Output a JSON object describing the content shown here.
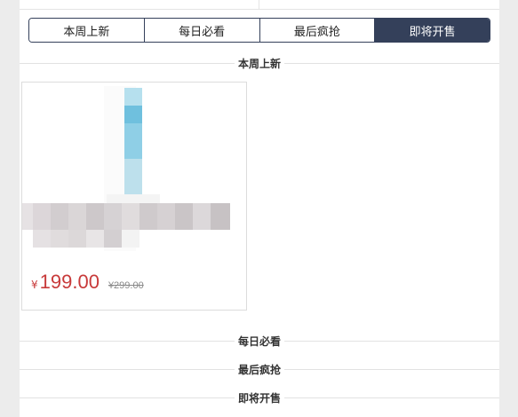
{
  "tabs": [
    {
      "label": "本周上新",
      "active": false
    },
    {
      "label": "每日必看",
      "active": false
    },
    {
      "label": "最后疯抢",
      "active": false
    },
    {
      "label": "即将开售",
      "active": true
    }
  ],
  "colors": {
    "accent": "#34405a",
    "price": "#c83a3a",
    "background": "#ececec"
  },
  "sections": {
    "new_this_week": "本周上新",
    "daily_picks": "每日必看",
    "last_rush": "最后疯抢",
    "coming_soon": "即将开售"
  },
  "product": {
    "currency_symbol": "¥",
    "price": "199.00",
    "original_price": "¥299.00",
    "image_icon": "pixelated-product-image"
  }
}
